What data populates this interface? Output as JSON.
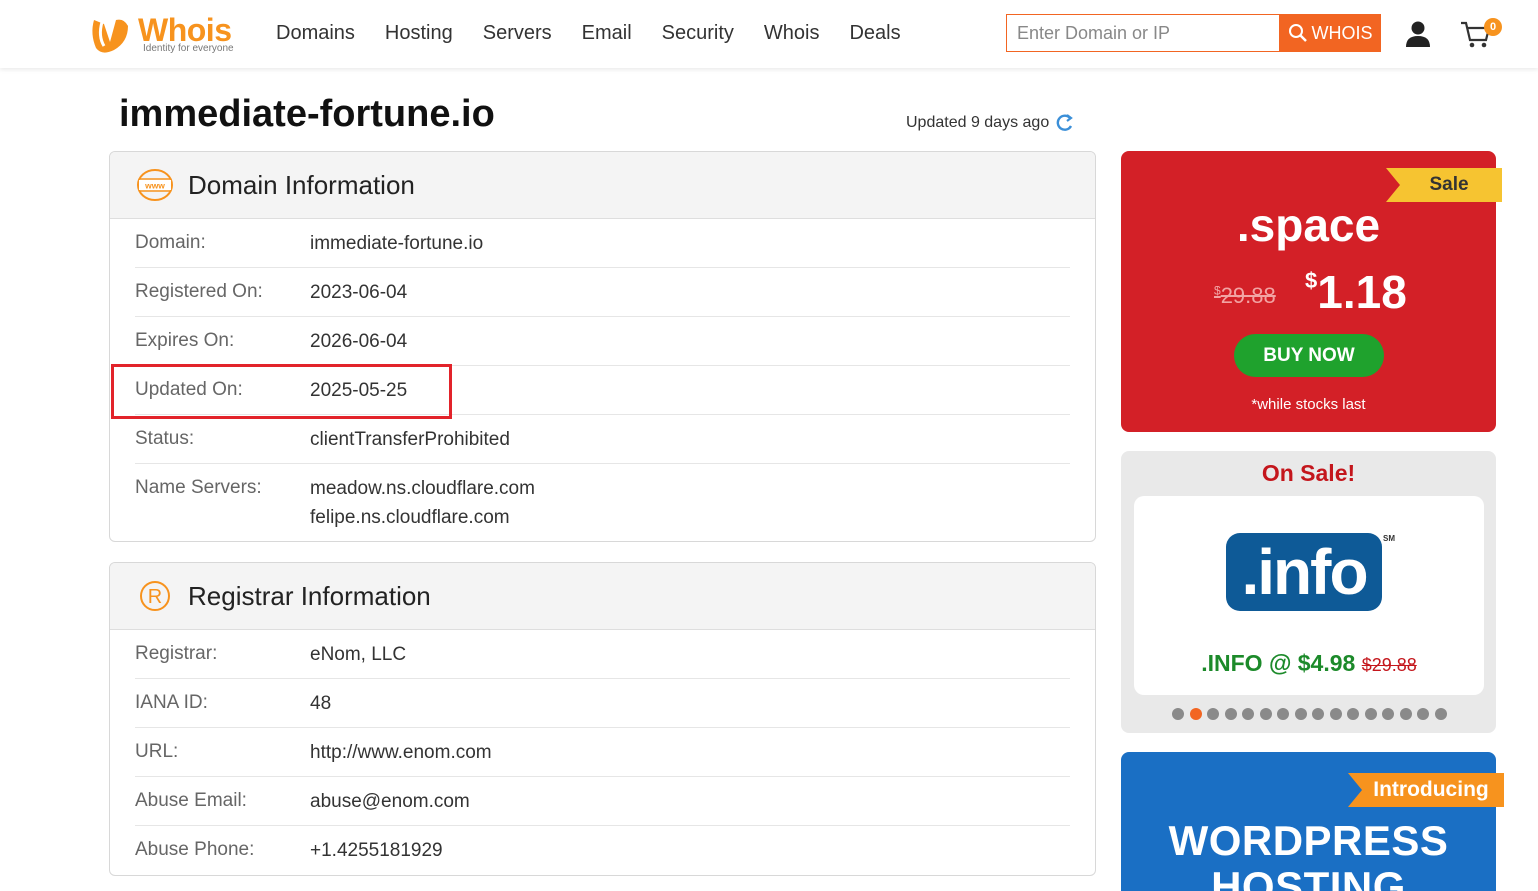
{
  "header": {
    "logo_text": "Whois",
    "logo_tagline": "Identity for everyone",
    "nav": [
      "Domains",
      "Hosting",
      "Servers",
      "Email",
      "Security",
      "Whois",
      "Deals"
    ],
    "search_placeholder": "Enter Domain or IP",
    "search_button": "WHOIS",
    "cart_count": "0"
  },
  "page": {
    "title": "immediate-fortune.io",
    "updated_text": "Updated 9 days ago"
  },
  "domain_info": {
    "heading": "Domain Information",
    "rows": [
      {
        "label": "Domain:",
        "value": "immediate-fortune.io"
      },
      {
        "label": "Registered On:",
        "value": "2023-06-04"
      },
      {
        "label": "Expires On:",
        "value": "2026-06-04"
      },
      {
        "label": "Updated On:",
        "value": "2025-05-25"
      },
      {
        "label": "Status:",
        "value": "clientTransferProhibited"
      },
      {
        "label": "Name Servers:",
        "value": "meadow.ns.cloudflare.com",
        "value2": "felipe.ns.cloudflare.com"
      }
    ]
  },
  "registrar_info": {
    "heading": "Registrar Information",
    "rows": [
      {
        "label": "Registrar:",
        "value": "eNom, LLC"
      },
      {
        "label": "IANA ID:",
        "value": "48"
      },
      {
        "label": "URL:",
        "value": "http://www.enom.com"
      },
      {
        "label": "Abuse Email:",
        "value": "abuse@enom.com"
      },
      {
        "label": "Abuse Phone:",
        "value": "+1.4255181929"
      }
    ]
  },
  "sidebar": {
    "sale": {
      "ribbon": "Sale",
      "tld": ".space",
      "old_currency": "$",
      "old_price": "29.88",
      "new_currency": "$",
      "new_price": "1.18",
      "button": "BUY NOW",
      "note": "*while stocks last"
    },
    "on_sale": {
      "title": "On Sale!",
      "logo_text": ".info",
      "logo_mark": "SM",
      "price": ".INFO @ $4.98",
      "old_price": "$29.88",
      "dot_count": 16,
      "active_dot": 1
    },
    "wordpress": {
      "ribbon": "Introducing",
      "line1": "WORDPRESS",
      "line2": "HOSTING"
    }
  },
  "colors": {
    "brand_orange": "#f26522",
    "sale_red": "#d32027",
    "buy_green": "#1fa22d",
    "highlight_red": "#e2232a",
    "info_blue": "#0e5a97"
  }
}
